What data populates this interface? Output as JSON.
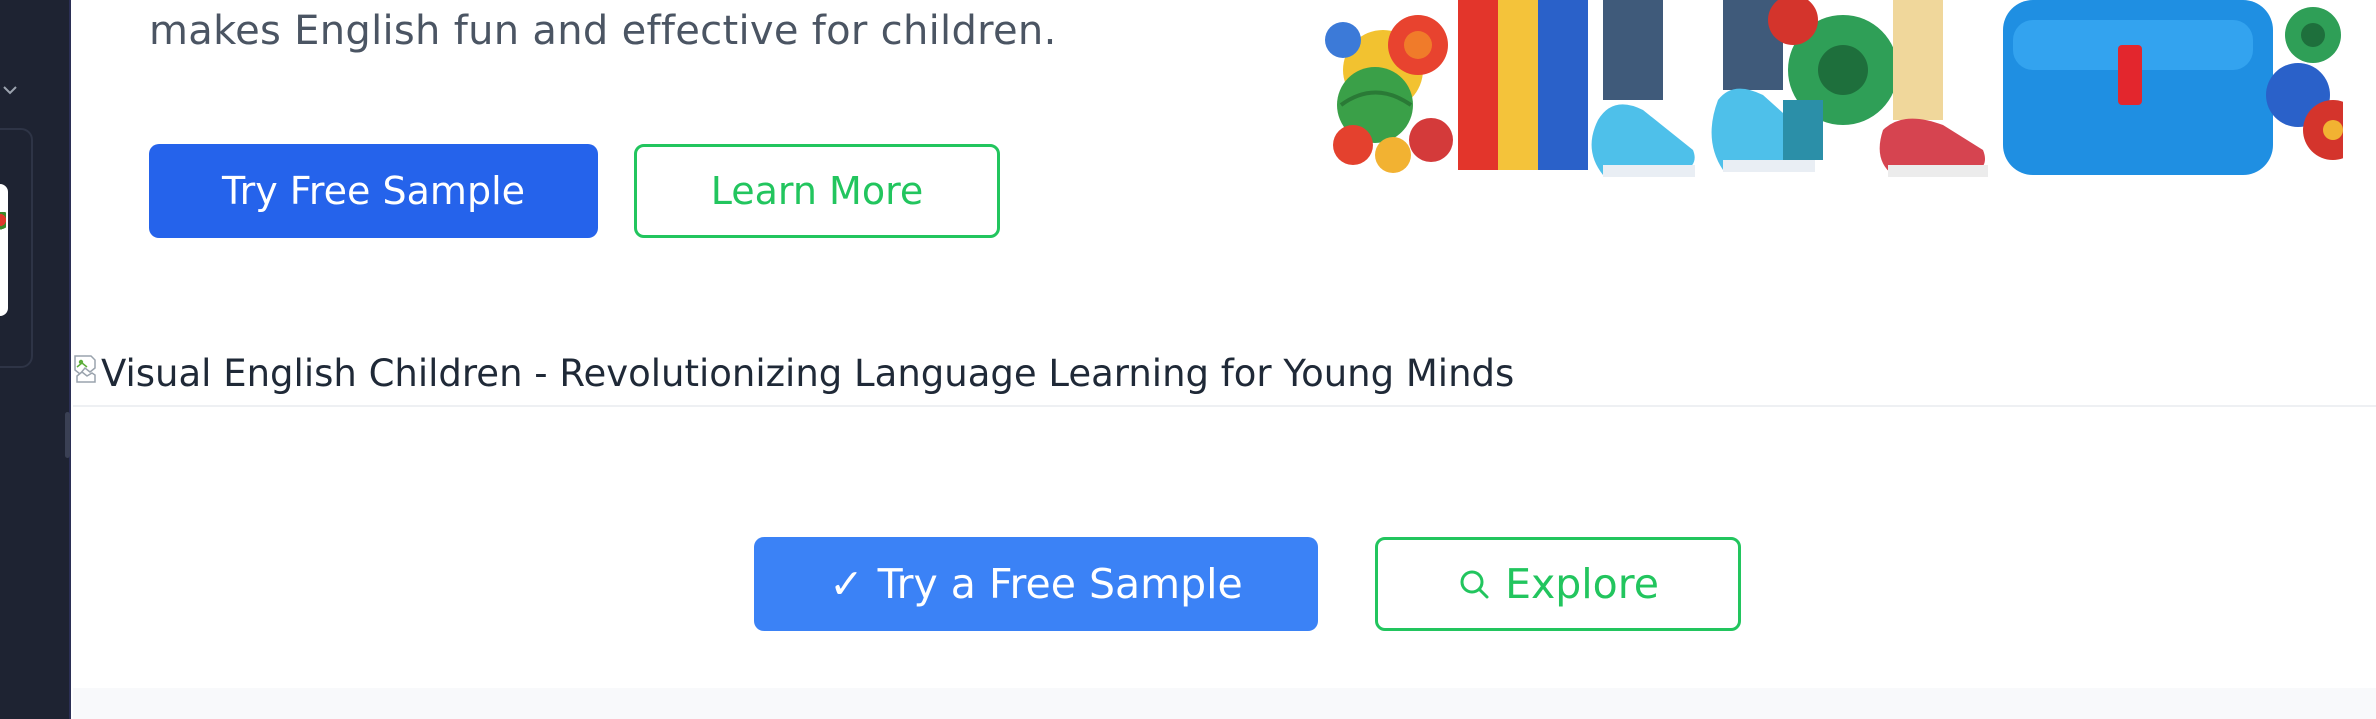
{
  "hero": {
    "text": "makes English fun and effective for children.",
    "primary_button": "Try Free Sample",
    "secondary_button": "Learn More"
  },
  "broken_image": {
    "alt": "Visual English Children - Revolutionizing Language Learning for Young Minds"
  },
  "cta": {
    "primary_button": "Try a Free Sample",
    "primary_icon": "checkmark-icon",
    "primary_icon_glyph": "✓",
    "secondary_button": "Explore",
    "secondary_icon": "search-icon"
  },
  "colors": {
    "sidebar_bg": "#1e2332",
    "primary_blue": "#2563eb",
    "primary_blue_light": "#3b82f6",
    "accent_green": "#22c55e",
    "text_gray": "#4b5563"
  }
}
